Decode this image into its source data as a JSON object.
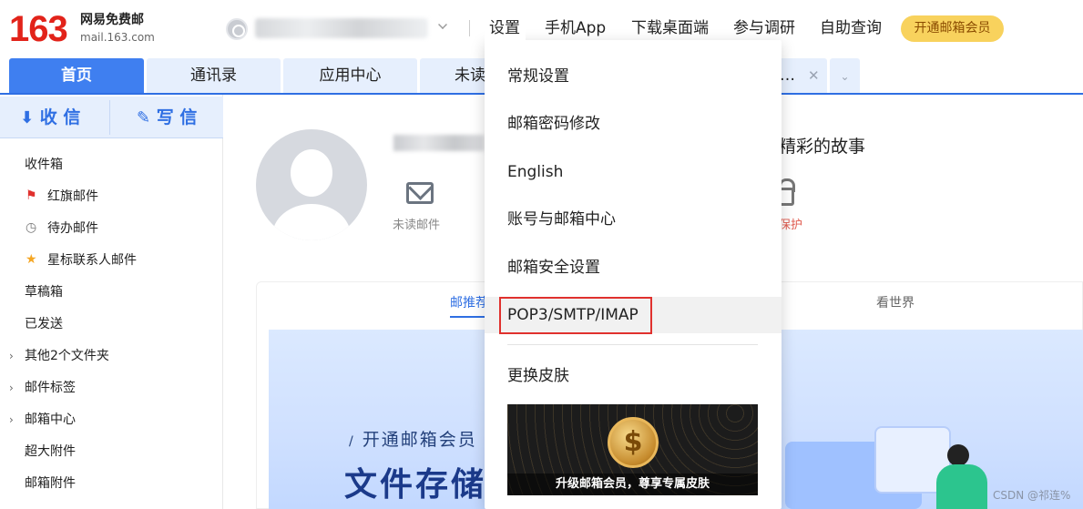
{
  "brand": {
    "number": "163",
    "name": "网易免费邮",
    "url": "mail.163.com",
    "red": "#e2231a",
    "blue": "#2f6fe3"
  },
  "topnav": {
    "settings": "设置",
    "mobile_app": "手机App",
    "download": "下载桌面端",
    "survey": "参与调研",
    "self_service": "自助查询",
    "vip": "开通邮箱会员"
  },
  "tabs": [
    {
      "label": "首页"
    },
    {
      "label": "通讯录"
    },
    {
      "label": "应用中心"
    },
    {
      "label": "未读"
    },
    {
      "label": "…"
    }
  ],
  "sidebar": {
    "receive": "收 信",
    "write": "写 信",
    "folders": [
      {
        "label": "收件箱",
        "icon": ""
      },
      {
        "label": "红旗邮件",
        "icon": "red-flag-icon"
      },
      {
        "label": "待办邮件",
        "icon": "clock-icon"
      },
      {
        "label": "星标联系人邮件",
        "icon": "star-icon"
      },
      {
        "label": "草稿箱",
        "icon": ""
      },
      {
        "label": "已发送",
        "icon": ""
      },
      {
        "label": "其他2个文件夹",
        "icon": ""
      },
      {
        "label": "邮件标签",
        "icon": ""
      },
      {
        "label": "邮箱中心",
        "icon": ""
      },
      {
        "label": "超大附件",
        "icon": ""
      },
      {
        "label": "邮箱附件",
        "icon": ""
      }
    ]
  },
  "main": {
    "slogan": "精彩的故事",
    "unread_label": "未读邮件",
    "protect_label": "保护",
    "feed_tabs": {
      "recommend": "邮推荐",
      "world": "看世界"
    },
    "banner_sub": "开通邮箱会员",
    "banner_title": "文件存储",
    "watermark": "CSDN @祁连%"
  },
  "menu": {
    "items": [
      "常规设置",
      "邮箱密码修改",
      "English",
      "账号与邮箱中心",
      "邮箱安全设置",
      "POP3/SMTP/IMAP",
      "更换皮肤"
    ],
    "skin_caption": "升级邮箱会员，尊享专属皮肤"
  }
}
